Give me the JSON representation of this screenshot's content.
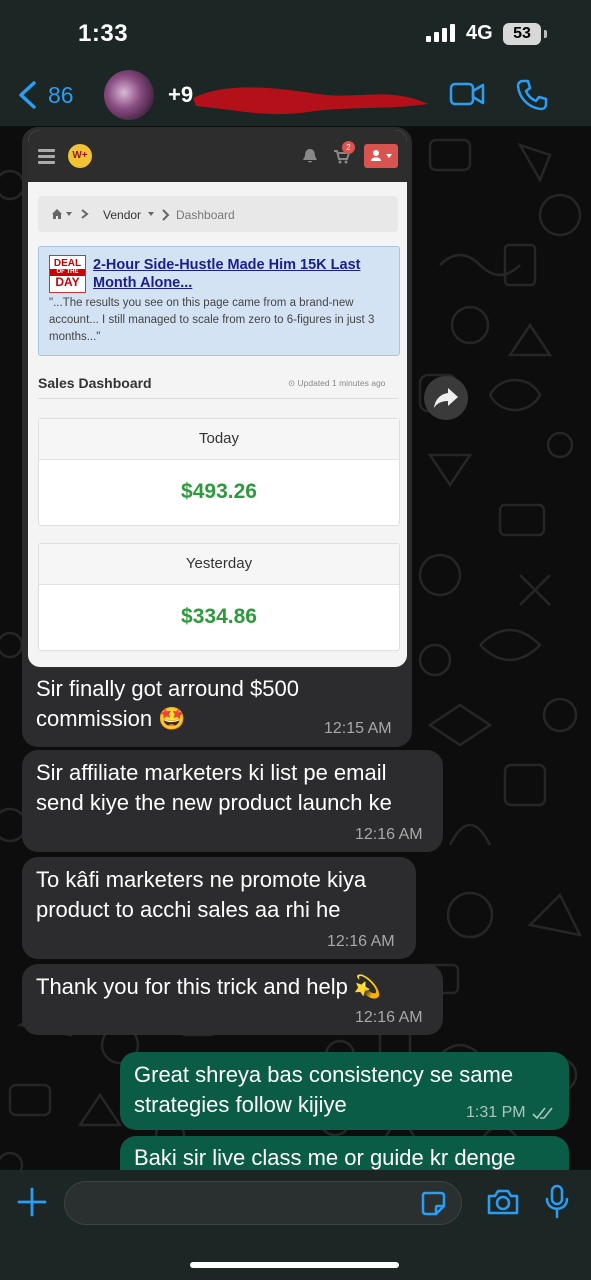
{
  "status_bar": {
    "time": "1:33",
    "network": "4G",
    "battery": "53"
  },
  "header": {
    "back_count": "86",
    "contact_name": "+9"
  },
  "screenshot": {
    "cart_badge": "2",
    "breadcrumb": {
      "vendor": "Vendor",
      "dashboard": "Dashboard"
    },
    "deal": {
      "badge_top": "DEAL",
      "badge_mid": "OF THE",
      "badge_bottom": "DAY",
      "title": "2-Hour Side-Hustle Made Him 15K Last Month Alone...",
      "body": "\"...The results you see on this page came from a brand-new account... I still managed to scale from zero to 6-figures in just 3 months...\""
    },
    "sales_title": "Sales Dashboard",
    "updated": "Updated 1 minutes ago",
    "today_label": "Today",
    "today_value": "$493.26",
    "yesterday_label": "Yesterday",
    "yesterday_value": "$334.86"
  },
  "messages": [
    {
      "text_line1": "Sir finally got arround $500",
      "text_line2": "commission 🤩",
      "time": "12:15 AM"
    },
    {
      "text_line1": "Sir affiliate marketers ki list pe email",
      "text_line2": "send kiye the new product launch ke",
      "time": "12:16 AM"
    },
    {
      "text_line1": "To kâfi marketers ne promote kiya",
      "text_line2": "product to acchi sales aa rhi he",
      "time": "12:16 AM"
    },
    {
      "text_line1": "Thank you for this trick and help 💫",
      "time": "12:16 AM"
    },
    {
      "text_line1": "Great shreya bas consistency se same",
      "text_line2": "strategies follow kijiye",
      "time": "1:31 PM"
    },
    {
      "text_line1": "Baki sir live class me or guide kr denge"
    }
  ],
  "colors": {
    "accent_blue": "#2a9df4",
    "outgoing_bubble": "#0b5c47",
    "incoming_bubble": "#2c2c2e",
    "sales_green": "#2d9a3c"
  }
}
